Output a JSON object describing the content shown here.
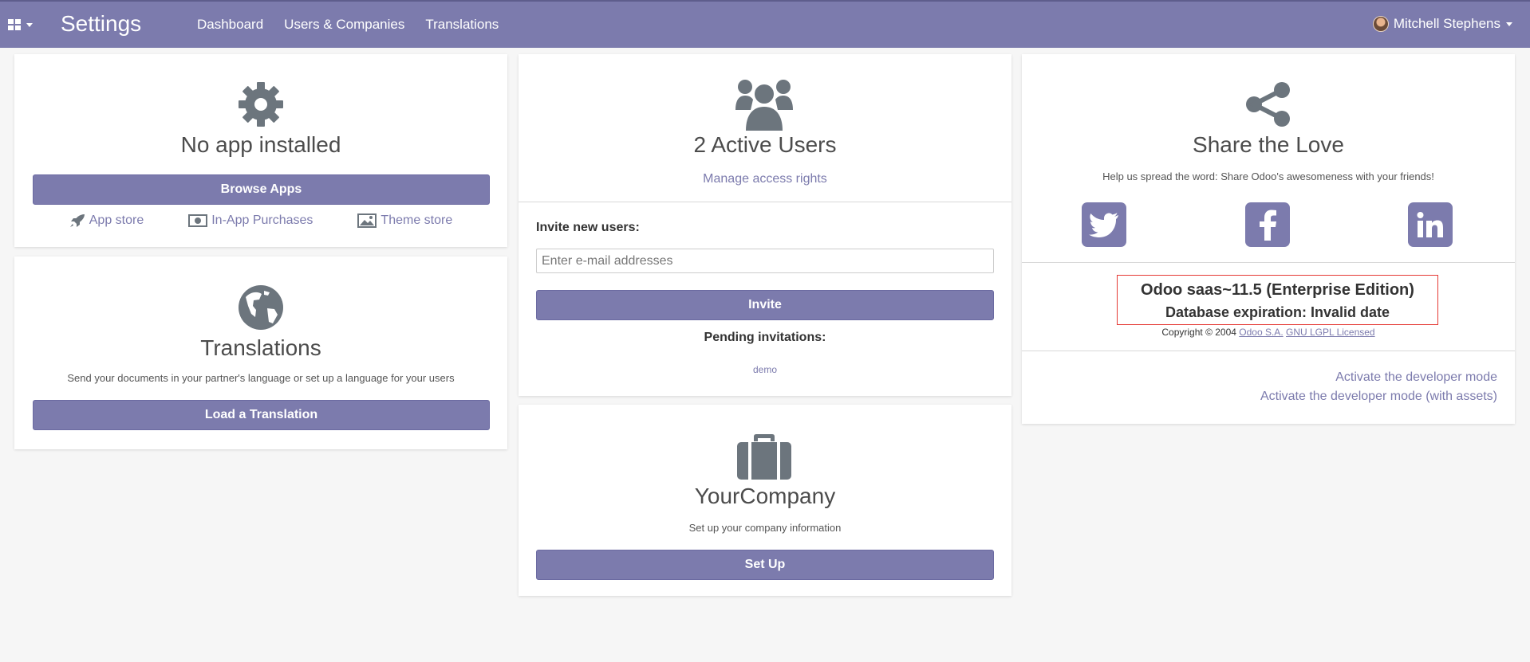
{
  "navbar": {
    "title": "Settings",
    "menu": [
      "Dashboard",
      "Users & Companies",
      "Translations"
    ],
    "user": "Mitchell Stephens"
  },
  "apps_card": {
    "icon": "gear-icon",
    "title": "No app installed",
    "button": "Browse Apps",
    "links": [
      "App store",
      "In-App Purchases",
      "Theme store"
    ]
  },
  "translations_card": {
    "icon": "globe-icon",
    "title": "Translations",
    "description": "Send your documents in your partner's language or set up a language for your users",
    "button": "Load a Translation"
  },
  "users_card": {
    "icon": "users-icon",
    "title": "2 Active Users",
    "manage_link": "Manage access rights",
    "invite_label": "Invite new users:",
    "invite_placeholder": "Enter e-mail addresses",
    "invite_button": "Invite",
    "pending_label": "Pending invitations:",
    "pending": [
      "demo"
    ]
  },
  "company_card": {
    "icon": "briefcase-icon",
    "title": "YourCompany",
    "description": "Set up your company information",
    "button": "Set Up"
  },
  "share_card": {
    "icon": "share-icon",
    "title": "Share the Love",
    "description": "Help us spread the word: Share Odoo's awesomeness with your friends!",
    "social": [
      "twitter-icon",
      "facebook-icon",
      "linkedin-icon"
    ],
    "version": "Odoo saas~11.5 (Enterprise Edition)",
    "expiration": "Database expiration: Invalid date",
    "copyright_prefix": "Copyright © 2004",
    "copyright_company": "Odoo S.A.",
    "copyright_license": "GNU LGPL Licensed",
    "dev_mode": "Activate the developer mode",
    "dev_mode_assets": "Activate the developer mode (with assets)"
  },
  "colors": {
    "primary": "#7c7bad",
    "background": "#f6f6f6",
    "icon_gray": "#6c757d",
    "highlight_border": "#e53935"
  }
}
